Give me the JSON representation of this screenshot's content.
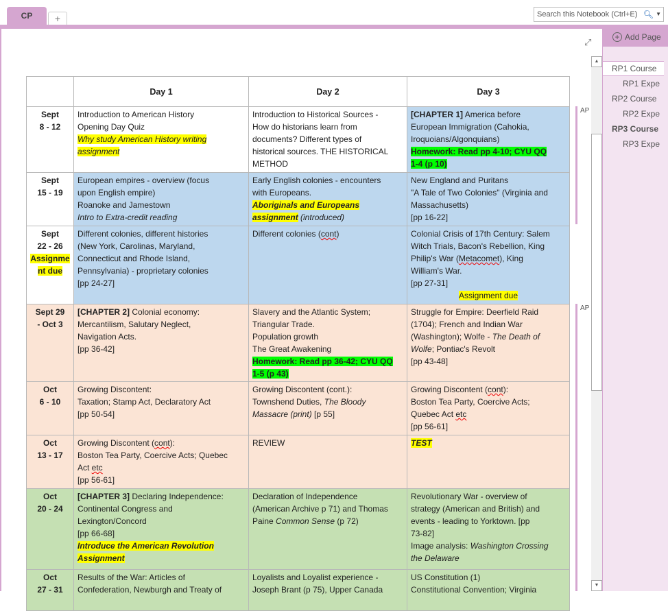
{
  "tabs": {
    "active": "CP",
    "add": "+"
  },
  "search": {
    "placeholder": "Search this Notebook (Ctrl+E)",
    "icon": "search-icon"
  },
  "pages": {
    "add_label": "Add Page",
    "items": [
      {
        "label": "RP1 Course",
        "selected": true
      },
      {
        "label": "RP1 Expe"
      },
      {
        "label": "RP2 Course"
      },
      {
        "label": "RP2 Expe"
      },
      {
        "label": "RP3 Course",
        "bold": true
      },
      {
        "label": "RP3 Expe"
      }
    ]
  },
  "markers": [
    "AP",
    "AP"
  ],
  "colors": {
    "accent": "#d5a6d0",
    "blue": "#bdd7ee",
    "peach": "#fbe4d5",
    "green": "#c5e0b3",
    "yellow": "#ffff00",
    "lime": "#00ff00"
  },
  "table": {
    "headers": [
      "",
      "Day 1",
      "Day 2",
      "Day 3"
    ],
    "rows": [
      {
        "bg": [
          "",
          "",
          "",
          "blue"
        ],
        "date": [
          [
            {
              "t": "Sept"
            }
          ],
          [
            {
              "t": "8 - 12"
            }
          ]
        ],
        "cells": [
          [
            [
              {
                "t": "Introduction to American History"
              }
            ],
            [
              {
                "t": "Opening Day Quiz"
              }
            ],
            [
              {
                "t": "Why study American History writing",
                "s": "i hl"
              }
            ],
            [
              {
                "t": "assignment",
                "s": "i hl"
              }
            ]
          ],
          [
            [
              {
                "t": "Introduction to Historical Sources -"
              }
            ],
            [
              {
                "t": "How do historians learn from"
              }
            ],
            [
              {
                "t": "documents? Different types of"
              }
            ],
            [
              {
                "t": "historical sources.  THE HISTORICAL"
              }
            ],
            [
              {
                "t": "METHOD"
              }
            ]
          ],
          [
            [
              {
                "t": "[CHAPTER 1]",
                "s": "b"
              },
              {
                "t": " America before"
              }
            ],
            [
              {
                "t": "European Immigration (Cahokia,"
              }
            ],
            [
              {
                "t": "Iroquoians/Algonquians)"
              }
            ],
            [
              {
                "t": "Homework: Read pp 4-10; CYU QQ",
                "s": "b hlg"
              }
            ],
            [
              {
                "t": "1-4 (p 10)",
                "s": "b hlg"
              }
            ]
          ]
        ]
      },
      {
        "bg": [
          "",
          "blue",
          "blue",
          "blue"
        ],
        "date": [
          [
            {
              "t": "Sept"
            }
          ],
          [
            {
              "t": "15 - 19"
            }
          ]
        ],
        "cells": [
          [
            [
              {
                "t": "European empires - overview (focus"
              }
            ],
            [
              {
                "t": "upon English empire)"
              }
            ],
            [
              {
                "t": "Roanoke and Jamestown"
              }
            ],
            [
              {
                "t": "Intro to Extra-credit reading",
                "s": "i"
              }
            ]
          ],
          [
            [
              {
                "t": "Early English colonies - encounters"
              }
            ],
            [
              {
                "t": "with Europeans."
              }
            ],
            [
              {
                "t": "Aboriginals and Europeans",
                "s": "b i hl"
              }
            ],
            [
              {
                "t": "assignment",
                "s": "b i hl"
              },
              {
                "t": " (introduced)",
                "s": "i"
              }
            ]
          ],
          [
            [
              {
                "t": "New England and Puritans"
              }
            ],
            [
              {
                "t": "\"A Tale of Two Colonies\" (Virginia and"
              }
            ],
            [
              {
                "t": "Massachusetts)"
              }
            ],
            [
              {
                "t": "[pp 16-22]"
              }
            ]
          ]
        ]
      },
      {
        "bg": [
          "",
          "blue",
          "blue",
          "blue"
        ],
        "date": [
          [
            {
              "t": "Sept"
            }
          ],
          [
            {
              "t": "22 - 26"
            }
          ],
          [
            {
              "t": "Assignme",
              "s": "hl"
            }
          ],
          [
            {
              "t": "nt due",
              "s": "hl"
            }
          ]
        ],
        "cells": [
          [
            [
              {
                "t": "Different colonies, different histories"
              }
            ],
            [
              {
                "t": "(New York, Carolinas, Maryland,"
              }
            ],
            [
              {
                "t": "Connecticut and Rhode Island,"
              }
            ],
            [
              {
                "t": "Pennsylvania) - proprietary colonies"
              }
            ],
            [
              {
                "t": "[pp 24-27]"
              }
            ]
          ],
          [
            [
              {
                "t": "Different colonies ("
              },
              {
                "t": "cont",
                "s": "sp"
              },
              {
                "t": ")"
              }
            ]
          ],
          [
            [
              {
                "t": "Colonial Crisis of 17th Century: Salem"
              }
            ],
            [
              {
                "t": "Witch Trials, Bacon's Rebellion, King"
              }
            ],
            [
              {
                "t": "Philip's War ("
              },
              {
                "t": "Metacomet",
                "s": "sp"
              },
              {
                "t": "), King"
              }
            ],
            [
              {
                "t": "William's War."
              }
            ],
            [
              {
                "t": "[pp 27-31]"
              }
            ],
            [
              {
                "t": "Assignment due",
                "s": "hl",
                "center": true
              }
            ]
          ]
        ]
      },
      {
        "bg": [
          "peach",
          "peach",
          "peach",
          "peach"
        ],
        "date": [
          [
            {
              "t": "Sept 29"
            }
          ],
          [
            {
              "t": "- Oct 3"
            }
          ]
        ],
        "cells": [
          [
            [
              {
                "t": "[CHAPTER 2]",
                "s": "b"
              },
              {
                "t": " Colonial economy:"
              }
            ],
            [
              {
                "t": "Mercantilism, Salutary Neglect,"
              }
            ],
            [
              {
                "t": "Navigation Acts."
              }
            ],
            [
              {
                "t": "[pp 36-42]"
              }
            ]
          ],
          [
            [
              {
                "t": "Slavery and the Atlantic System;"
              }
            ],
            [
              {
                "t": "Triangular Trade."
              }
            ],
            [
              {
                "t": "Population growth"
              }
            ],
            [
              {
                "t": "The Great Awakening"
              }
            ],
            [
              {
                "t": "Homework: Read pp 36-42; CYU QQ",
                "s": "b hlg"
              }
            ],
            [
              {
                "t": "1-5 (p 43)",
                "s": "b hlg"
              }
            ]
          ],
          [
            [
              {
                "t": "Struggle for Empire: Deerfield Raid"
              }
            ],
            [
              {
                "t": "(1704); French and Indian War"
              }
            ],
            [
              {
                "t": "(Washington); Wolfe - "
              },
              {
                "t": "The Death of",
                "s": "i"
              }
            ],
            [
              {
                "t": "Wolfe",
                "s": "i"
              },
              {
                "t": "; Pontiac's Revolt"
              }
            ],
            [
              {
                "t": "[pp 43-48]"
              }
            ]
          ]
        ]
      },
      {
        "bg": [
          "peach",
          "peach",
          "peach",
          "peach"
        ],
        "date": [
          [
            {
              "t": "Oct"
            }
          ],
          [
            {
              "t": "6 - 10"
            }
          ]
        ],
        "cells": [
          [
            [
              {
                "t": "Growing Discontent:"
              }
            ],
            [
              {
                "t": "Taxation; Stamp Act, Declaratory Act"
              }
            ],
            [
              {
                "t": "[pp 50-54]"
              }
            ]
          ],
          [
            [
              {
                "t": "Growing Discontent (cont.):"
              }
            ],
            [
              {
                "t": "Townshend Duties, "
              },
              {
                "t": "The Bloody",
                "s": "i"
              }
            ],
            [
              {
                "t": "Massacre (print)",
                "s": "i"
              },
              {
                "t": " [p 55]"
              }
            ]
          ],
          [
            [
              {
                "t": "Growing Discontent ("
              },
              {
                "t": "cont",
                "s": "sp"
              },
              {
                "t": "):"
              }
            ],
            [
              {
                "t": "Boston Tea Party, Coercive Acts;"
              }
            ],
            [
              {
                "t": "Quebec Act "
              },
              {
                "t": "etc",
                "s": "sp"
              }
            ],
            [
              {
                "t": "[pp 56-61]"
              }
            ]
          ]
        ]
      },
      {
        "bg": [
          "peach",
          "peach",
          "peach",
          "peach"
        ],
        "date": [
          [
            {
              "t": "Oct"
            }
          ],
          [
            {
              "t": "13 - 17"
            }
          ]
        ],
        "cells": [
          [
            [
              {
                "t": "Growing Discontent ("
              },
              {
                "t": "cont",
                "s": "sp"
              },
              {
                "t": "):"
              }
            ],
            [
              {
                "t": "Boston Tea Party, Coercive Acts; Quebec"
              }
            ],
            [
              {
                "t": "Act "
              },
              {
                "t": "etc",
                "s": "sp"
              }
            ],
            [
              {
                "t": "[pp 56-61]"
              }
            ]
          ],
          [
            [
              {
                "t": "REVIEW"
              }
            ]
          ],
          [
            [
              {
                "t": "TEST",
                "s": "b i hl"
              }
            ]
          ]
        ]
      },
      {
        "bg": [
          "green",
          "green",
          "green",
          "green"
        ],
        "date": [
          [
            {
              "t": "Oct"
            }
          ],
          [
            {
              "t": "20 - 24"
            }
          ]
        ],
        "cells": [
          [
            [
              {
                "t": "[CHAPTER 3]",
                "s": "b"
              },
              {
                "t": " Declaring Independence:"
              }
            ],
            [
              {
                "t": "Continental Congress and"
              }
            ],
            [
              {
                "t": "Lexington/Concord"
              }
            ],
            [
              {
                "t": "[pp 66-68]"
              }
            ],
            [
              {
                "t": "Introduce the American Revolution",
                "s": "b i hl"
              }
            ],
            [
              {
                "t": "Assignment",
                "s": "b i hl"
              }
            ]
          ],
          [
            [
              {
                "t": "Declaration of Independence"
              }
            ],
            [
              {
                "t": "(American Archive p 71) and Thomas"
              }
            ],
            [
              {
                "t": "Paine "
              },
              {
                "t": "Common Sense",
                "s": "i"
              },
              {
                "t": " (p 72)"
              }
            ]
          ],
          [
            [
              {
                "t": "Revolutionary War - overview of"
              }
            ],
            [
              {
                "t": "strategy (American and British) and"
              }
            ],
            [
              {
                "t": "events - leading to Yorktown. [pp"
              }
            ],
            [
              {
                "t": "73-82]"
              }
            ],
            [
              {
                "t": "Image analysis: "
              },
              {
                "t": "Washington Crossing",
                "s": "i"
              }
            ],
            [
              {
                "t": "the Delaware",
                "s": "i"
              }
            ]
          ]
        ]
      },
      {
        "bg": [
          "green",
          "green",
          "green",
          "green"
        ],
        "date": [
          [
            {
              "t": "Oct"
            }
          ],
          [
            {
              "t": "27 - 31"
            }
          ]
        ],
        "cells": [
          [
            [
              {
                "t": "Results of the War: Articles of"
              }
            ],
            [
              {
                "t": "Confederation, Newburgh and Treaty of"
              }
            ]
          ],
          [
            [
              {
                "t": "Loyalists and Loyalist experience -"
              }
            ],
            [
              {
                "t": "Joseph Brant (p 75), Upper Canada"
              }
            ]
          ],
          [
            [
              {
                "t": "US Constitution (1)"
              }
            ],
            [
              {
                "t": "Constitutional Convention; Virginia"
              }
            ]
          ]
        ]
      }
    ]
  }
}
